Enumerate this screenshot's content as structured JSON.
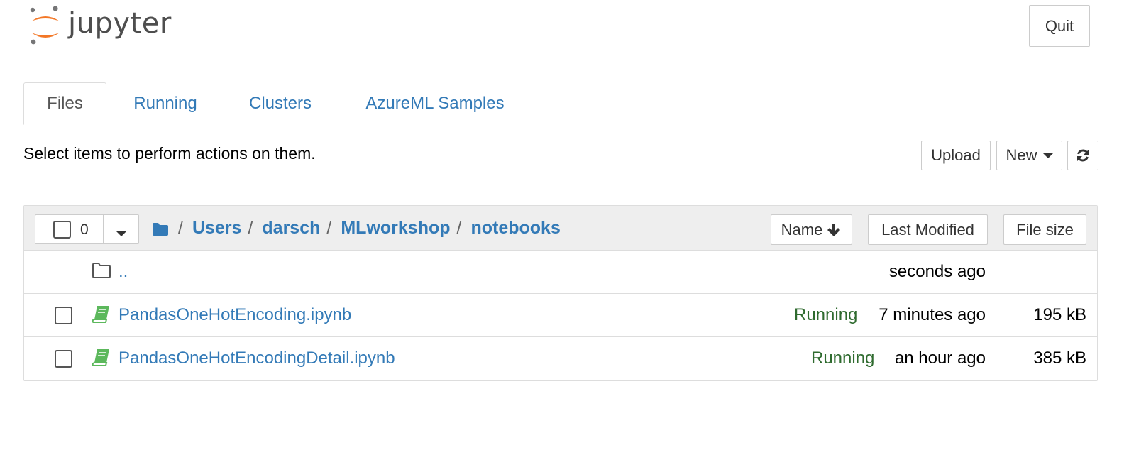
{
  "header": {
    "logo_text": "jupyter",
    "quit_label": "Quit"
  },
  "tabs": [
    {
      "label": "Files",
      "active": true
    },
    {
      "label": "Running",
      "active": false
    },
    {
      "label": "Clusters",
      "active": false
    },
    {
      "label": "AzureML Samples",
      "active": false
    }
  ],
  "toolbar": {
    "hint": "Select items to perform actions on them.",
    "upload_label": "Upload",
    "new_label": "New",
    "refresh_icon": "refresh-icon"
  },
  "list": {
    "selected_count": "0",
    "breadcrumb_separator": "/",
    "breadcrumb": [
      "Users",
      "darsch",
      "MLworkshop",
      "notebooks"
    ],
    "sort_buttons": {
      "name": "Name",
      "last_modified": "Last Modified",
      "file_size": "File size"
    },
    "rows": [
      {
        "type": "folder",
        "name": "..",
        "status": "",
        "modified": "seconds ago",
        "size": ""
      },
      {
        "type": "notebook",
        "name": "PandasOneHotEncoding.ipynb",
        "status": "Running",
        "modified": "7 minutes ago",
        "size": "195 kB"
      },
      {
        "type": "notebook",
        "name": "PandasOneHotEncodingDetail.ipynb",
        "status": "Running",
        "modified": "an hour ago",
        "size": "385 kB"
      }
    ]
  },
  "colors": {
    "link": "#337ab7",
    "running": "#2f6b2f",
    "notebook_icon": "#5cb85c",
    "logo_orange": "#f37726"
  }
}
